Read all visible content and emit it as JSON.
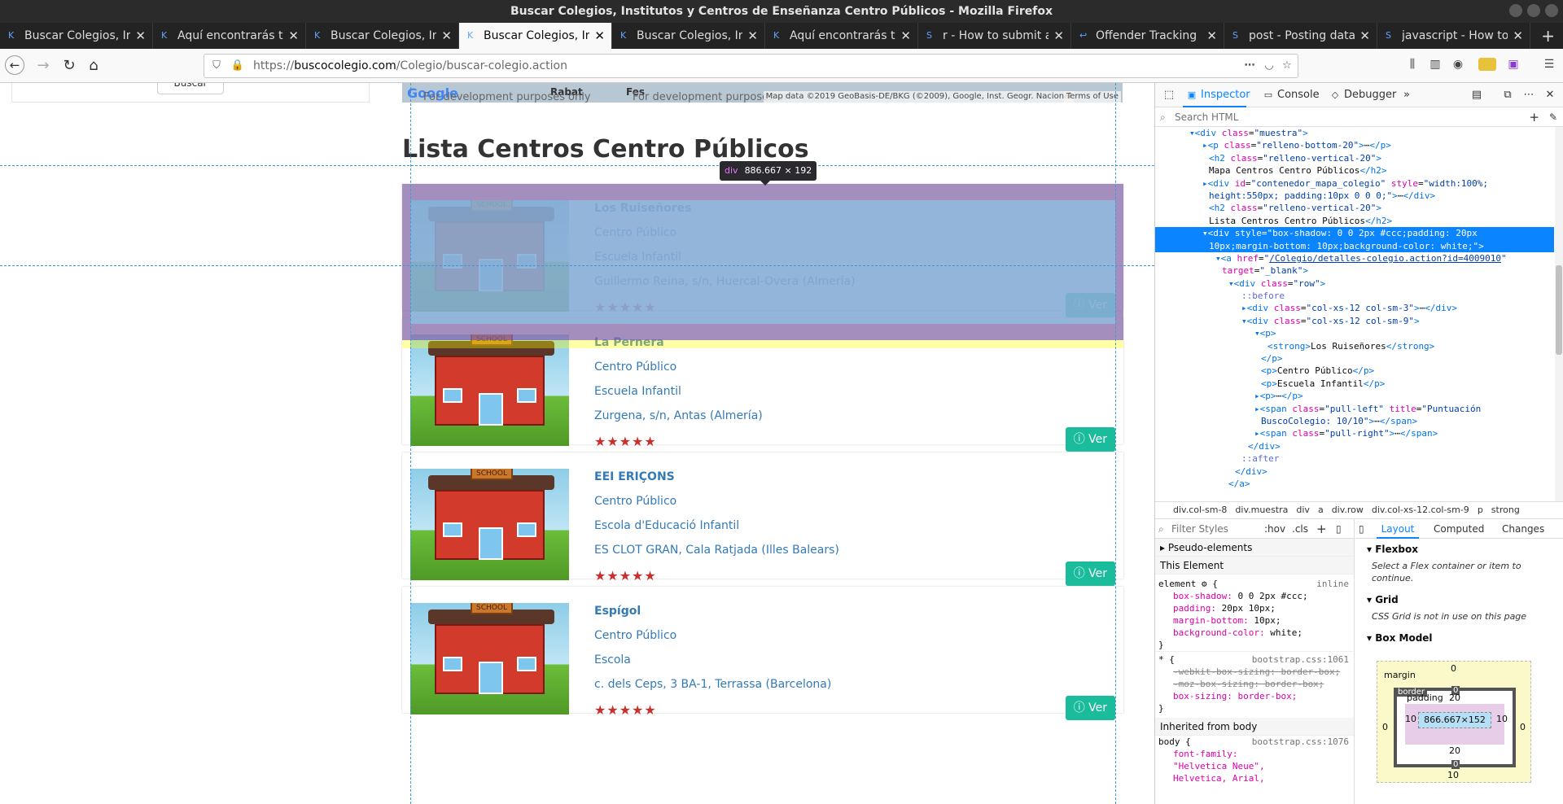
{
  "window": {
    "title": "Buscar Colegios, Institutos y Centros de Enseñanza Centro Públicos - Mozilla Firefox"
  },
  "tabs": [
    {
      "label": "Buscar Colegios, In",
      "icon": "K"
    },
    {
      "label": "Aquí encontrarás t",
      "icon": "K"
    },
    {
      "label": "Buscar Colegios, In",
      "icon": "K"
    },
    {
      "label": "Buscar Colegios, In",
      "icon": "K",
      "active": true
    },
    {
      "label": "Buscar Colegios, In",
      "icon": "K"
    },
    {
      "label": "Aquí encontrarás t",
      "icon": "K"
    },
    {
      "label": "r - How to submit a",
      "icon": "S"
    },
    {
      "label": "Offender Tracking",
      "icon": "↩"
    },
    {
      "label": "post - Posting data",
      "icon": "S"
    },
    {
      "label": "javascript - How to",
      "icon": "S"
    }
  ],
  "url": {
    "prefix": "https://",
    "host": "buscocolegio.com",
    "path": "/Colegio/buscar-colegio.action"
  },
  "page": {
    "left_button": "Buscar",
    "map": {
      "dev1": "For development purposes only",
      "dev2": "For development purposes on",
      "town1": "Rabat",
      "town2": "Fes",
      "attribution": "Map data ©2019 GeoBasis-DE/BKG (©2009), Google, Inst. Geogr. Nacional",
      "terms": "Terms of Use",
      "logo": "Google"
    },
    "heading": "Lista Centros Centro Públicos",
    "tooltip": {
      "tag": "div",
      "size": "886.667 × 192"
    },
    "schools": [
      {
        "name": "Los Ruiseñores",
        "type": "Centro Público",
        "level": "Escuela Infantil",
        "address": "Guillermo Reina, s/n, Huercal-Overa (Almería)",
        "stars": "★★★★★",
        "button": "Ver"
      },
      {
        "name": "La Pernera",
        "type": "Centro Público",
        "level": "Escuela Infantil",
        "address": "Zurgena, s/n, Antas (Almería)",
        "stars": "★★★★★",
        "button": "Ver"
      },
      {
        "name": "EEI ERIÇONS",
        "type": "Centro Público",
        "level": "Escola d'Educació Infantil",
        "address": "ES CLOT GRAN, Cala Ratjada (Illes Balears)",
        "stars": "★★★★★",
        "button": "Ver"
      },
      {
        "name": "Espígol",
        "type": "Centro Público",
        "level": "Escola",
        "address": "c. dels Ceps, 3 BA-1, Terrassa (Barcelona)",
        "stars": "★★★★★",
        "button": "Ver"
      }
    ],
    "sign_text": "SCHOOL"
  },
  "devtools": {
    "tabs": {
      "inspector": "Inspector",
      "console": "Console",
      "debugger": "Debugger"
    },
    "search_placeholder": "Search HTML",
    "breadcrumb": [
      "div.col-sm-8",
      "div.muestra",
      "div",
      "a",
      "div.row",
      "div.col-xs-12.col-sm-9",
      "p",
      "strong"
    ],
    "styles_filter": "Filter Styles",
    "hov": ":hov",
    "cls": ".cls",
    "layout_tabs": {
      "layout": "Layout",
      "computed": "Computed",
      "changes": "Changes"
    },
    "pseudo": "Pseudo-elements",
    "this_element": "This Element",
    "element_rule": {
      "selector": "element",
      "origin": "inline",
      "props": [
        {
          "name": "box-shadow",
          "value": "0 0 2px #ccc;"
        },
        {
          "name": "padding",
          "value": "20px 10px;"
        },
        {
          "name": "margin-bottom",
          "value": "10px;"
        },
        {
          "name": "background-color",
          "value": "white;"
        }
      ]
    },
    "star_rule": {
      "selector": "* {",
      "origin": "bootstrap.css:1061",
      "props": [
        "-webkit-box-sizing: border-box;",
        "-moz-box-sizing: border-box;"
      ],
      "active": "box-sizing: border-box;"
    },
    "inherited": "Inherited from body",
    "body_rule": {
      "selector": "body {",
      "origin": "bootstrap.css:1076",
      "prop": "font-family: \"Helvetica Neue\", Helvetica, Arial,"
    },
    "flexbox": {
      "title": "Flexbox",
      "note": "Select a Flex container or item to continue."
    },
    "grid": {
      "title": "Grid",
      "note": "CSS Grid is not in use on this page"
    },
    "boxmodel": {
      "title": "Box Model",
      "margin_label": "margin",
      "border_label": "border",
      "padding_label": "padding",
      "content": "866.667×152",
      "margin_top": "0",
      "margin_bottom": "10",
      "margin_left": "0",
      "margin_right": "0",
      "border_top": "0",
      "border_bottom": "0",
      "border_left": "0",
      "border_right": "0",
      "padding_top": "20",
      "padding_bottom": "20",
      "padding_left": "10",
      "padding_right": "10"
    },
    "tree": [
      {
        "indent": 4,
        "html": "<span class='tg'>▾&lt;div</span> <span class='at'>class</span>=<span class='av'>\"muestra\"</span><span class='tg'>&gt;</span>"
      },
      {
        "indent": 6,
        "html": "<span class='tg'>▸&lt;p</span> <span class='at'>class</span>=<span class='av'>\"relleno-bottom-20\"</span><span class='tg'>&gt;</span>⋯<span class='tg'>&lt;/p&gt;</span>"
      },
      {
        "indent": 7,
        "html": "<span class='tg'>&lt;h2</span> <span class='at'>class</span>=<span class='av'>\"relleno-vertical-20\"</span><span class='tg'>&gt;</span>"
      },
      {
        "indent": 7,
        "html": "<span class='txtn'>Mapa Centros Centro Públicos</span><span class='tg'>&lt;/h2&gt;</span>"
      },
      {
        "indent": 6,
        "html": "<span class='tg'>▸&lt;div</span> <span class='at'>id</span>=<span class='av'>\"contenedor_mapa_colegio\"</span> <span class='at'>style</span>=<span class='av'>\"width:100%;</span>"
      },
      {
        "indent": 7,
        "html": "<span class='av'>height:550px; padding:10px 0 0 0;\"</span><span class='tg'>&gt;</span>⋯<span class='tg'>&lt;/div&gt;</span>"
      },
      {
        "indent": 7,
        "html": "<span class='tg'>&lt;h2</span> <span class='at'>class</span>=<span class='av'>\"relleno-vertical-20\"</span><span class='tg'>&gt;</span>"
      },
      {
        "indent": 7,
        "html": "<span class='txtn'>Lista Centros Centro Públicos</span><span class='tg'>&lt;/h2&gt;</span>"
      },
      {
        "indent": 6,
        "sel": true,
        "html": "▾&lt;div style=\"box-shadow: 0 0 2px #ccc;padding: 20px"
      },
      {
        "indent": 7,
        "sel": true,
        "html": "10px;margin-bottom: 10px;background-color: white;\"&gt;"
      },
      {
        "indent": 8,
        "html": "<span class='tg'>▾&lt;a</span> <span class='at'>href</span>=<span class='av'>\"<u>/Colegio/detalles-colegio.action?id=4009010</u>\"</span>"
      },
      {
        "indent": 9,
        "html": "<span class='at'>target</span>=<span class='av'>\"_blank\"</span><span class='tg'>&gt;</span>"
      },
      {
        "indent": 10,
        "html": "<span class='tg'>▾&lt;div</span> <span class='at'>class</span>=<span class='av'>\"row\"</span><span class='tg'>&gt;</span>"
      },
      {
        "indent": 12,
        "html": "<span class='ps'>::before</span>"
      },
      {
        "indent": 12,
        "html": "<span class='tg'>▸&lt;div</span> <span class='at'>class</span>=<span class='av'>\"col-xs-12 col-sm-3\"</span><span class='tg'>&gt;</span>⋯<span class='tg'>&lt;/div&gt;</span>"
      },
      {
        "indent": 12,
        "html": "<span class='tg'>▾&lt;div</span> <span class='at'>class</span>=<span class='av'>\"col-xs-12 col-sm-9\"</span><span class='tg'>&gt;</span>"
      },
      {
        "indent": 14,
        "html": "<span class='tg'>▾&lt;p&gt;</span>"
      },
      {
        "indent": 16,
        "html": "<span class='tg'>&lt;strong&gt;</span><span class='txtn'>Los Ruiseñores</span><span class='tg'>&lt;/strong&gt;</span>"
      },
      {
        "indent": 15,
        "html": "<span class='tg'>&lt;/p&gt;</span>"
      },
      {
        "indent": 15,
        "html": "<span class='tg'>&lt;p&gt;</span><span class='txtn'>Centro Público</span><span class='tg'>&lt;/p&gt;</span>"
      },
      {
        "indent": 15,
        "html": "<span class='tg'>&lt;p&gt;</span><span class='txtn'>Escuela Infantil</span><span class='tg'>&lt;/p&gt;</span>"
      },
      {
        "indent": 14,
        "html": "<span class='tg'>▸&lt;p&gt;</span>⋯<span class='tg'>&lt;/p&gt;</span>"
      },
      {
        "indent": 14,
        "html": "<span class='tg'>▸&lt;span</span> <span class='at'>class</span>=<span class='av'>\"pull-left\"</span> <span class='at'>title</span>=<span class='av'>\"Puntuación</span>"
      },
      {
        "indent": 15,
        "html": "<span class='av'>BuscoColegio: 10/10\"</span><span class='tg'>&gt;</span>⋯<span class='tg'>&lt;/span&gt;</span>"
      },
      {
        "indent": 14,
        "html": "<span class='tg'>▸&lt;span</span> <span class='at'>class</span>=<span class='av'>\"pull-right\"</span><span class='tg'>&gt;</span>⋯<span class='tg'>&lt;/span&gt;</span>"
      },
      {
        "indent": 13,
        "html": "<span class='tg'>&lt;/div&gt;</span>"
      },
      {
        "indent": 12,
        "html": "<span class='ps'>::after</span>"
      },
      {
        "indent": 11,
        "html": "<span class='tg'>&lt;/div&gt;</span>"
      },
      {
        "indent": 10,
        "html": "<span class='tg'>&lt;/a&gt;</span>"
      }
    ]
  }
}
